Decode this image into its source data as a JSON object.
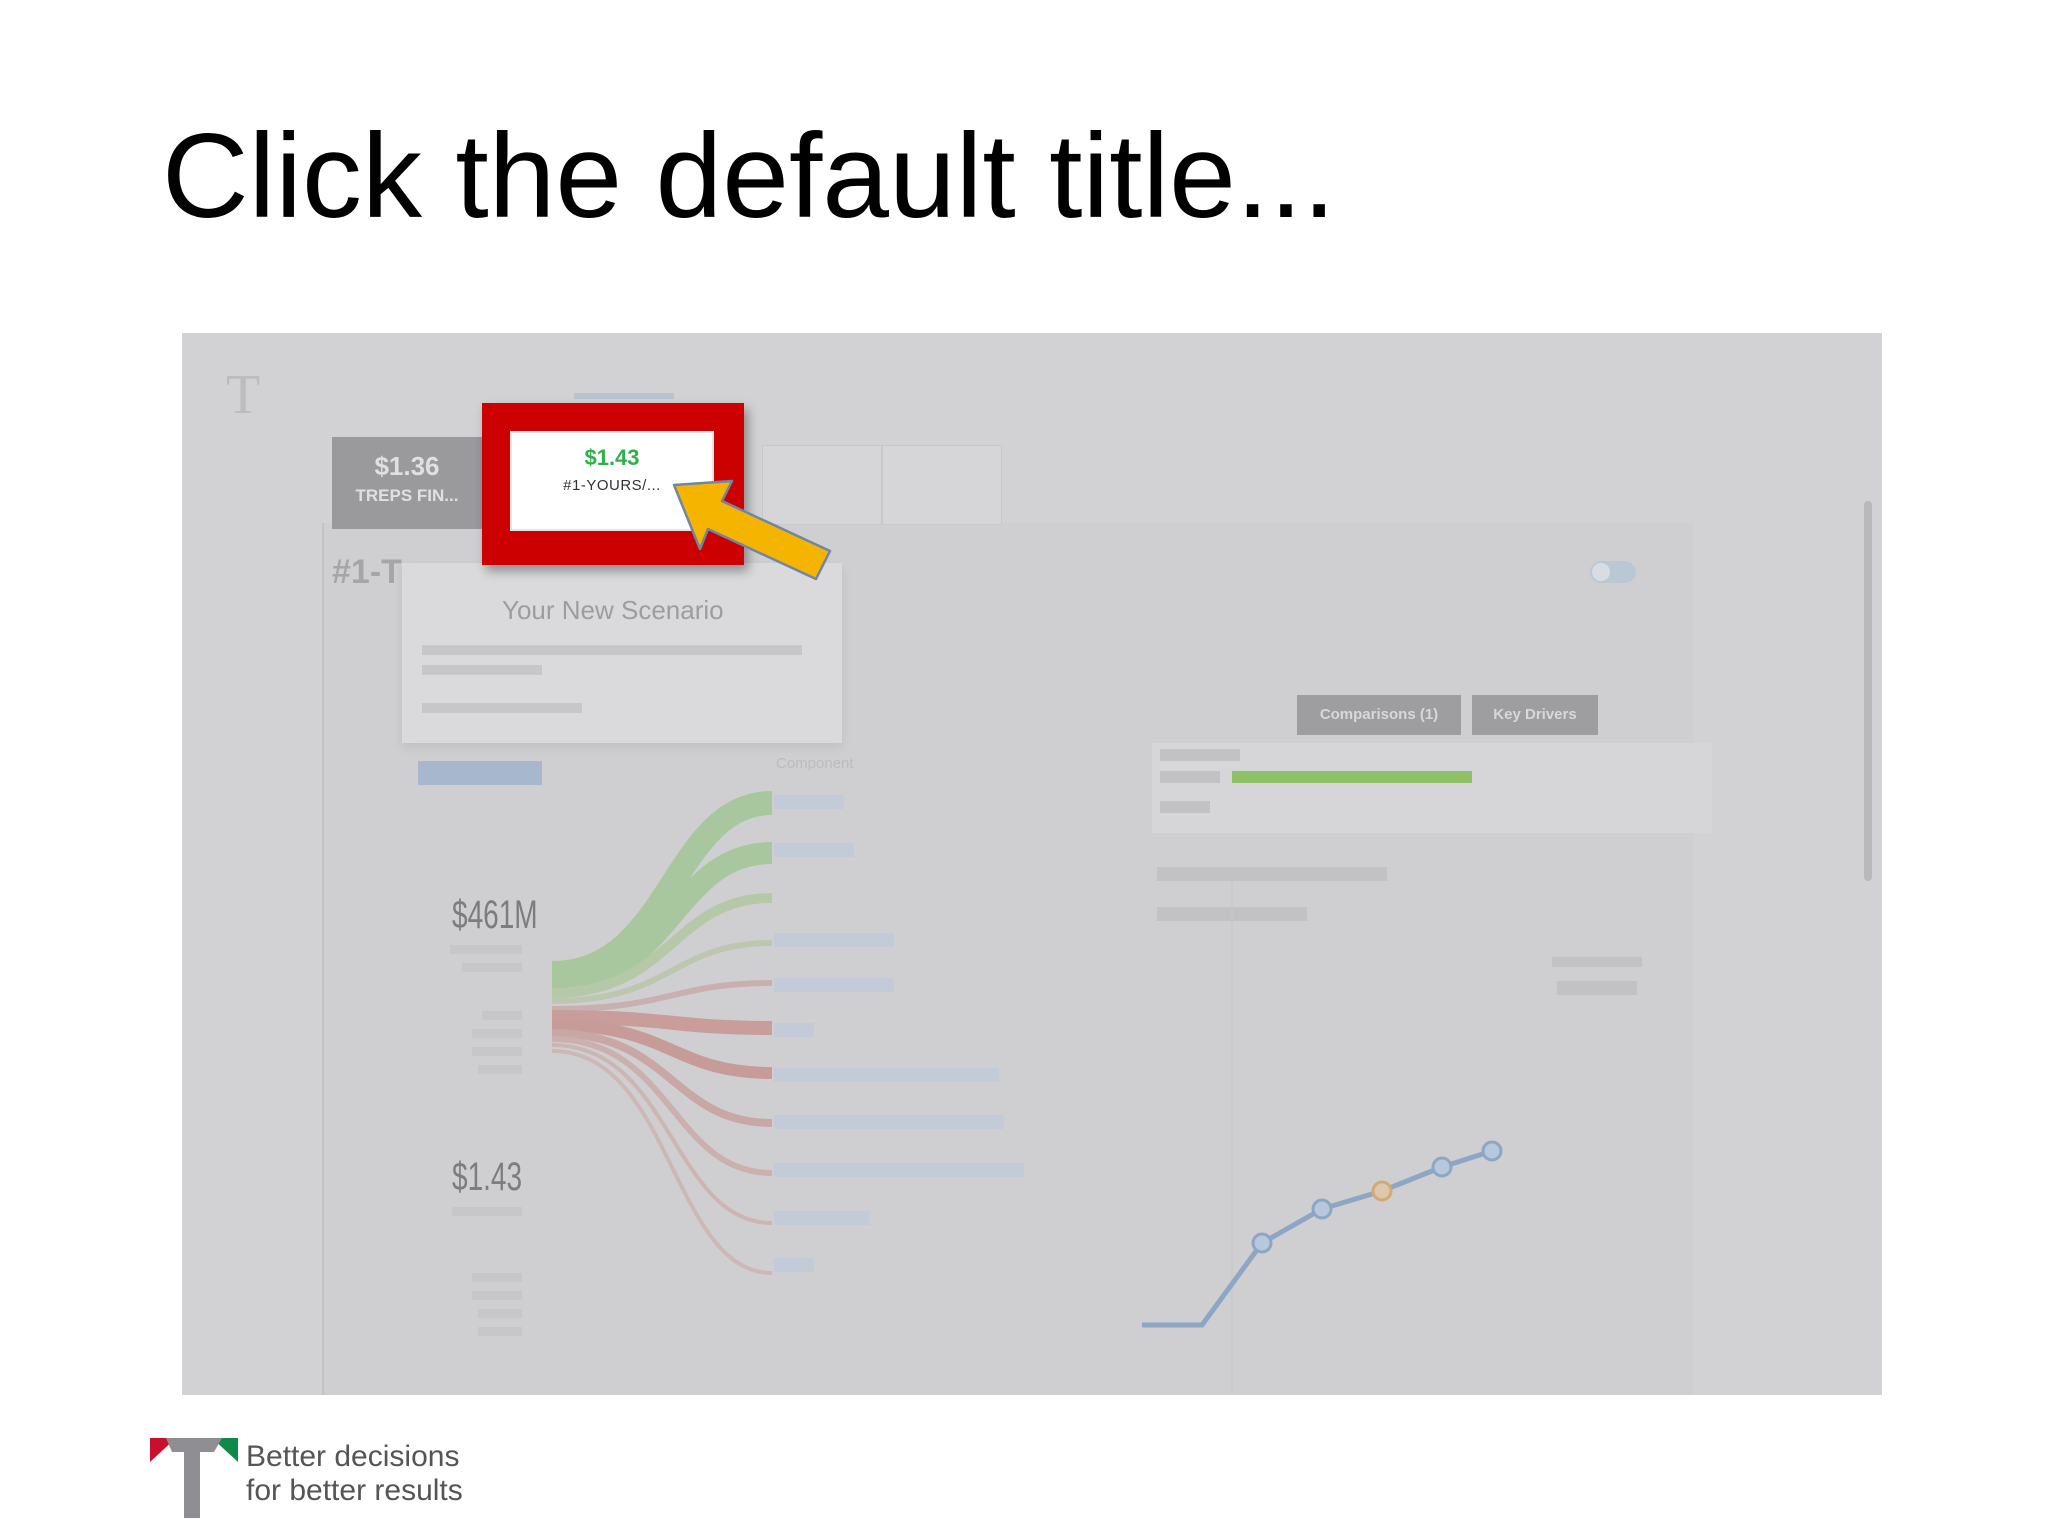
{
  "slide": {
    "title": "Click the default title..."
  },
  "screenshot": {
    "tab_active": {
      "value": "$1.36",
      "label": "TREPS FIN..."
    },
    "tab_highlighted": {
      "value": "$1.43",
      "label": "#1-YOURS/..."
    },
    "scenario_heading": "#1-T",
    "popup_title": "Your New Scenario",
    "component_label": "Component",
    "left_value_1": "$461M",
    "left_value_2": "$1.43",
    "right_tabs": [
      "Comparisons (1)",
      "Key Drivers"
    ],
    "highlight_color": "#cc0000",
    "arrow_color": "#f5b400",
    "value_color": "#2fb14a"
  },
  "footer": {
    "tagline_line1": "Better decisions",
    "tagline_line2": "for better results",
    "logo_icon": "t-logo-icon",
    "logo_colors": {
      "red": "#c8102e",
      "green": "#0f8a4a",
      "gray": "#8e8e93"
    }
  }
}
